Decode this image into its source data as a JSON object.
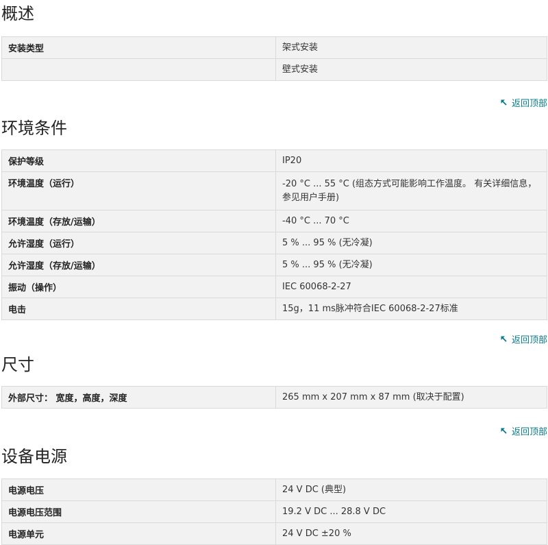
{
  "overview": {
    "title": "概述",
    "rows": [
      {
        "label": "安装类型",
        "value": "架式安装"
      },
      {
        "label": "",
        "value": "壁式安装"
      }
    ]
  },
  "environment": {
    "title": "环境条件",
    "rows": [
      {
        "label": "保护等级",
        "value": "IP20"
      },
      {
        "label": "环境温度（运行）",
        "value": "-20 °C ... 55 °C (组态方式可能影响工作温度。 有关详细信息，参见用户手册)"
      },
      {
        "label": "环境温度（存放/运输）",
        "value": "-40 °C ... 70 °C"
      },
      {
        "label": "允许湿度（运行）",
        "value": "5 % ... 95 % (无冷凝)"
      },
      {
        "label": "允许湿度（存放/运输）",
        "value": "5 % ... 95 % (无冷凝)"
      },
      {
        "label": "振动（操作）",
        "value": "IEC 60068-2-27"
      },
      {
        "label": "电击",
        "value": "15g，11 ms脉冲符合IEC 60068-2-27标准"
      }
    ]
  },
  "dimensions": {
    "title": "尺寸",
    "rows": [
      {
        "label": "外部尺寸： 宽度，高度，深度",
        "value": "265 mm x 207 mm x 87 mm (取决于配置)"
      }
    ]
  },
  "power": {
    "title": "设备电源",
    "rows": [
      {
        "label": "电源电压",
        "value": "24 V DC (典型)"
      },
      {
        "label": "电源电压范围",
        "value": "19.2 V DC ... 28.8 V DC"
      },
      {
        "label": "电源单元",
        "value": "24 V DC ±20 %"
      }
    ]
  },
  "back_to_top_label": "返回顶部",
  "colors": {
    "link": "#0a7a8a",
    "row_bg": "#f2f2f2",
    "border": "#d9d9d9"
  },
  "icons": {
    "back_to_top": "arrow-up-left-icon"
  }
}
